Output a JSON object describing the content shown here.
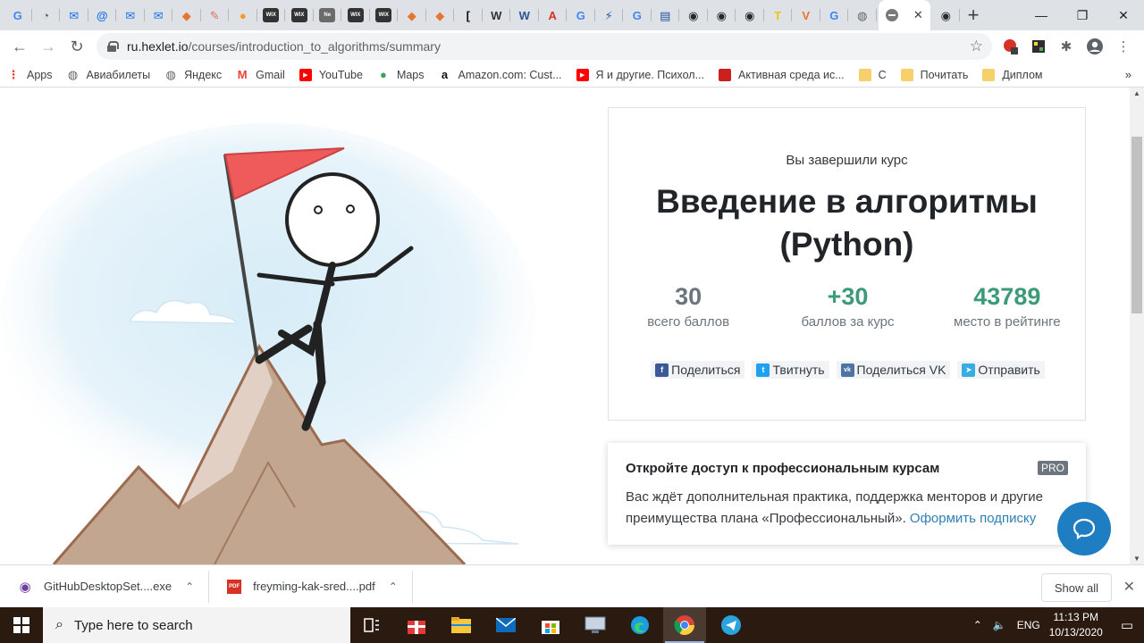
{
  "tabs": [
    {
      "icon": "google-icon",
      "letter": "G",
      "color": "#4285f4"
    },
    {
      "icon": "speed-icon",
      "letter": "◔",
      "color": "#5f6368"
    },
    {
      "icon": "mail-icon",
      "letter": "✉",
      "color": "#1a73e8"
    },
    {
      "icon": "at-mail-icon",
      "letter": "@",
      "color": "#1a73e8"
    },
    {
      "icon": "mail-icon",
      "letter": "✉",
      "color": "#1a73e8"
    },
    {
      "icon": "mail-icon",
      "letter": "✉",
      "color": "#1a73e8"
    },
    {
      "icon": "fox-icon",
      "letter": "◆",
      "color": "#e8742d"
    },
    {
      "icon": "brush-icon",
      "letter": "✎",
      "color": "#e06c5a"
    },
    {
      "icon": "orange-icon",
      "letter": "●",
      "color": "#f29b34"
    },
    {
      "icon": "wix-icon",
      "letter": "WIX",
      "color": "#333333"
    },
    {
      "icon": "wix-icon",
      "letter": "WIX",
      "color": "#333333"
    },
    {
      "icon": "ne-icon",
      "letter": "Ne",
      "color": "#6b6b6b"
    },
    {
      "icon": "wix-icon",
      "letter": "WIX",
      "color": "#333333"
    },
    {
      "icon": "wix-icon",
      "letter": "WIX",
      "color": "#333333"
    },
    {
      "icon": "fox-icon",
      "letter": "◆",
      "color": "#e8742d"
    },
    {
      "icon": "fox-icon",
      "letter": "◆",
      "color": "#e8742d"
    },
    {
      "icon": "bracket-icon",
      "letter": "[",
      "color": "#111111"
    },
    {
      "icon": "wikipedia-icon",
      "letter": "W",
      "color": "#333333"
    },
    {
      "icon": "w-icon",
      "letter": "W",
      "color": "#2b5797"
    },
    {
      "icon": "red-badge-icon",
      "letter": "A",
      "color": "#d93025"
    },
    {
      "icon": "google-icon",
      "letter": "G",
      "color": "#4285f4"
    },
    {
      "icon": "doc-icon",
      "letter": "⚡",
      "color": "#1a5dab"
    },
    {
      "icon": "google-icon",
      "letter": "G",
      "color": "#4285f4"
    },
    {
      "icon": "blue-doc-icon",
      "letter": "▤",
      "color": "#1f4e9c"
    },
    {
      "icon": "github-icon",
      "letter": "◉",
      "color": "#24292e"
    },
    {
      "icon": "github-icon",
      "letter": "◉",
      "color": "#24292e"
    },
    {
      "icon": "github-icon",
      "letter": "◉",
      "color": "#24292e"
    },
    {
      "icon": "t-icon",
      "letter": "T",
      "color": "#f1c40f"
    },
    {
      "icon": "v-icon",
      "letter": "V",
      "color": "#e8742d"
    },
    {
      "icon": "google-icon",
      "letter": "G",
      "color": "#4285f4"
    },
    {
      "icon": "globe-icon",
      "letter": "◍",
      "color": "#5f6368"
    }
  ],
  "active_tab": {
    "icon": "hexlet-icon",
    "close": "✕"
  },
  "after_tab": {
    "icon": "github-icon",
    "letter": "◉",
    "color": "#24292e"
  },
  "new_tab": "+",
  "window": {
    "minimize": "—",
    "maximize": "❐",
    "close": "✕"
  },
  "address": {
    "host": "ru.hexlet.io",
    "path": "/courses/introduction_to_algorithms/summary"
  },
  "bookmarks": [
    {
      "label": "Apps",
      "icon": "apps-icon",
      "color": "#ea4335",
      "glyph": "⋮"
    },
    {
      "label": "Авиабилеты",
      "icon": "globe-icon",
      "color": "#5f6368",
      "glyph": "◍"
    },
    {
      "label": "Яндекс",
      "icon": "globe-icon",
      "color": "#5f6368",
      "glyph": "◍"
    },
    {
      "label": "Gmail",
      "icon": "gmail-icon",
      "color": "#ea4335",
      "glyph": "M"
    },
    {
      "label": "YouTube",
      "icon": "youtube-icon",
      "color": "#ff0000",
      "glyph": "▶"
    },
    {
      "label": "Maps",
      "icon": "maps-icon",
      "color": "#34a853",
      "glyph": "●"
    },
    {
      "label": "Amazon.com: Cust...",
      "icon": "amazon-icon",
      "color": "#111111",
      "glyph": "a"
    },
    {
      "label": "Я и другие. Психол...",
      "icon": "youtube-icon",
      "color": "#ff0000",
      "glyph": "▶"
    },
    {
      "label": "Активная среда ис...",
      "icon": "red-square-icon",
      "color": "#cc1f1f",
      "glyph": ""
    },
    {
      "label": "С",
      "icon": "folder-icon",
      "color": "#f6d06a",
      "glyph": ""
    },
    {
      "label": "Почитать",
      "icon": "folder-icon",
      "color": "#f6d06a",
      "glyph": ""
    },
    {
      "label": "Диплом",
      "icon": "folder-icon",
      "color": "#f6d06a",
      "glyph": ""
    }
  ],
  "bookmarks_more": "»",
  "course": {
    "completed_label": "Вы завершили курс",
    "title": "Введение в алгоритмы (Python)",
    "stats": [
      {
        "value": "30",
        "label": "всего баллов",
        "color": "#6c757d"
      },
      {
        "value": "+30",
        "label": "баллов за курс",
        "color": "#3c9a78"
      },
      {
        "value": "43789",
        "label": "место в рейтинге",
        "color": "#3c9a78"
      }
    ],
    "share": [
      {
        "label": "Поделиться",
        "icon": "facebook-icon",
        "color": "#3b5998",
        "glyph": "f"
      },
      {
        "label": "Твитнуть",
        "icon": "twitter-icon",
        "color": "#1da1f2",
        "glyph": "t"
      },
      {
        "label": "Поделиться VK",
        "icon": "vk-icon",
        "color": "#4c75a3",
        "glyph": "vk"
      },
      {
        "label": "Отправить",
        "icon": "telegram-icon",
        "color": "#37aee2",
        "glyph": "➤"
      }
    ]
  },
  "pro": {
    "title": "Откройте доступ к профессиональным курсам",
    "badge": "PRO",
    "text": "Вас ждёт дополнительная практика, поддержка менторов и другие преимущества плана «Профессиональный». ",
    "link": "Оформить подписку"
  },
  "downloads": [
    {
      "name": "GitHubDesktopSet....exe",
      "icon": "github-icon",
      "color": "#6e3fa3"
    },
    {
      "name": "freyming-kak-sred....pdf",
      "icon": "pdf-icon",
      "color": "#d93025"
    }
  ],
  "show_all": "Show all",
  "taskbar": {
    "search_placeholder": "Type here to search",
    "lang": "ENG",
    "time": "11:13 PM",
    "date": "10/13/2020"
  },
  "colors": {
    "accent": "#3c9a78",
    "link": "#2f7fb5",
    "chat": "#1f7dc1",
    "taskbar": "#2b1a10"
  }
}
